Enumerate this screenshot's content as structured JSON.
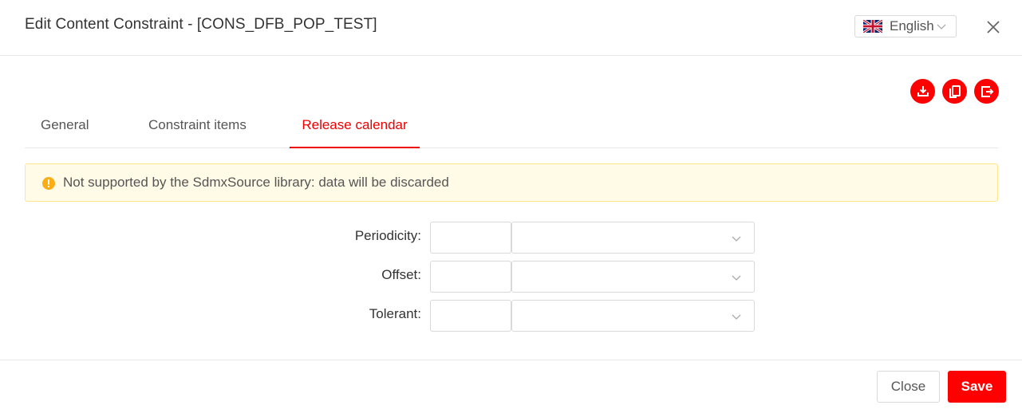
{
  "dialog": {
    "title": "Edit Content Constraint - [CONS_DFB_POP_TEST]",
    "language": {
      "selected": "English",
      "icon": "uk-flag-icon"
    },
    "close_icon": "close-icon"
  },
  "actions": [
    {
      "name": "download-button",
      "icon": "download-icon"
    },
    {
      "name": "copy-button",
      "icon": "copy-icon"
    },
    {
      "name": "export-button",
      "icon": "export-icon"
    }
  ],
  "tabs": [
    {
      "label": "General",
      "active": false
    },
    {
      "label": "Constraint items",
      "active": false
    },
    {
      "label": "Release calendar",
      "active": true
    }
  ],
  "alert": {
    "type": "warning",
    "message": "Not supported by the SdmxSource library: data will be discarded"
  },
  "form": {
    "periodicity": {
      "label": "Periodicity",
      "value": "",
      "unit": ""
    },
    "offset": {
      "label": "Offset",
      "value": "",
      "unit": ""
    },
    "tolerance": {
      "label": "Tolerant",
      "value": "",
      "unit": ""
    },
    "separator": ":"
  },
  "footer": {
    "close_label": "Close",
    "save_label": "Save"
  },
  "colors": {
    "accent": "#ff0000",
    "warning_bg": "#fffbe6",
    "warning_border": "#ffe58f",
    "warning_icon": "#faad14"
  }
}
